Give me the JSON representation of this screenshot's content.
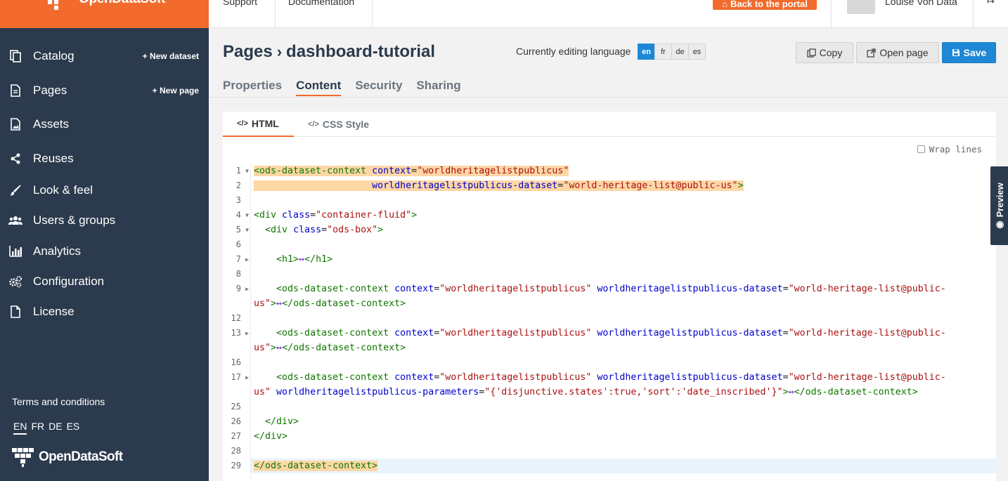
{
  "sidebar": {
    "brand": "OpenDataSoft",
    "items": [
      {
        "label": "Catalog",
        "extra": "+ New dataset"
      },
      {
        "label": "Pages",
        "extra": "+ New page"
      },
      {
        "label": "Assets",
        "extra": ""
      },
      {
        "label": "Reuses",
        "extra": ""
      },
      {
        "label": "Look & feel",
        "extra": ""
      },
      {
        "label": "Users & groups",
        "extra": ""
      },
      {
        "label": "Analytics",
        "extra": ""
      },
      {
        "label": "Configuration",
        "extra": ""
      },
      {
        "label": "License",
        "extra": ""
      }
    ],
    "terms": "Terms and conditions",
    "languages": [
      "EN",
      "FR",
      "DE",
      "ES"
    ],
    "footer_brand": "OpenDataSoft"
  },
  "topbar": {
    "support": "Support",
    "documentation": "Documentation",
    "back_to_portal": "Back to the portal",
    "user_name": "Louise Von Data"
  },
  "header": {
    "crumb_root": "Pages",
    "crumb_page": "dashboard-tutorial",
    "editing_language_label": "Currently editing language",
    "languages": [
      "en",
      "fr",
      "de",
      "es"
    ],
    "active_language": "en",
    "copy": "Copy",
    "open_page": "Open page",
    "save": "Save"
  },
  "tabs": [
    "Properties",
    "Content",
    "Security",
    "Sharing"
  ],
  "editor": {
    "subtabs": [
      "HTML",
      "CSS Style"
    ],
    "wrap_lines": "Wrap lines",
    "line_numbers": [
      "1",
      "2",
      "3",
      "4",
      "5",
      "6",
      "7",
      "8",
      "9",
      "",
      "12",
      "13",
      "",
      "16",
      "17",
      "",
      "25",
      "26",
      "27",
      "28",
      "29"
    ]
  },
  "preview_label": "Preview",
  "colors": {
    "sidebar": "#2b3a4d",
    "accent": "#f26b2c",
    "primary": "#1e88d6"
  }
}
